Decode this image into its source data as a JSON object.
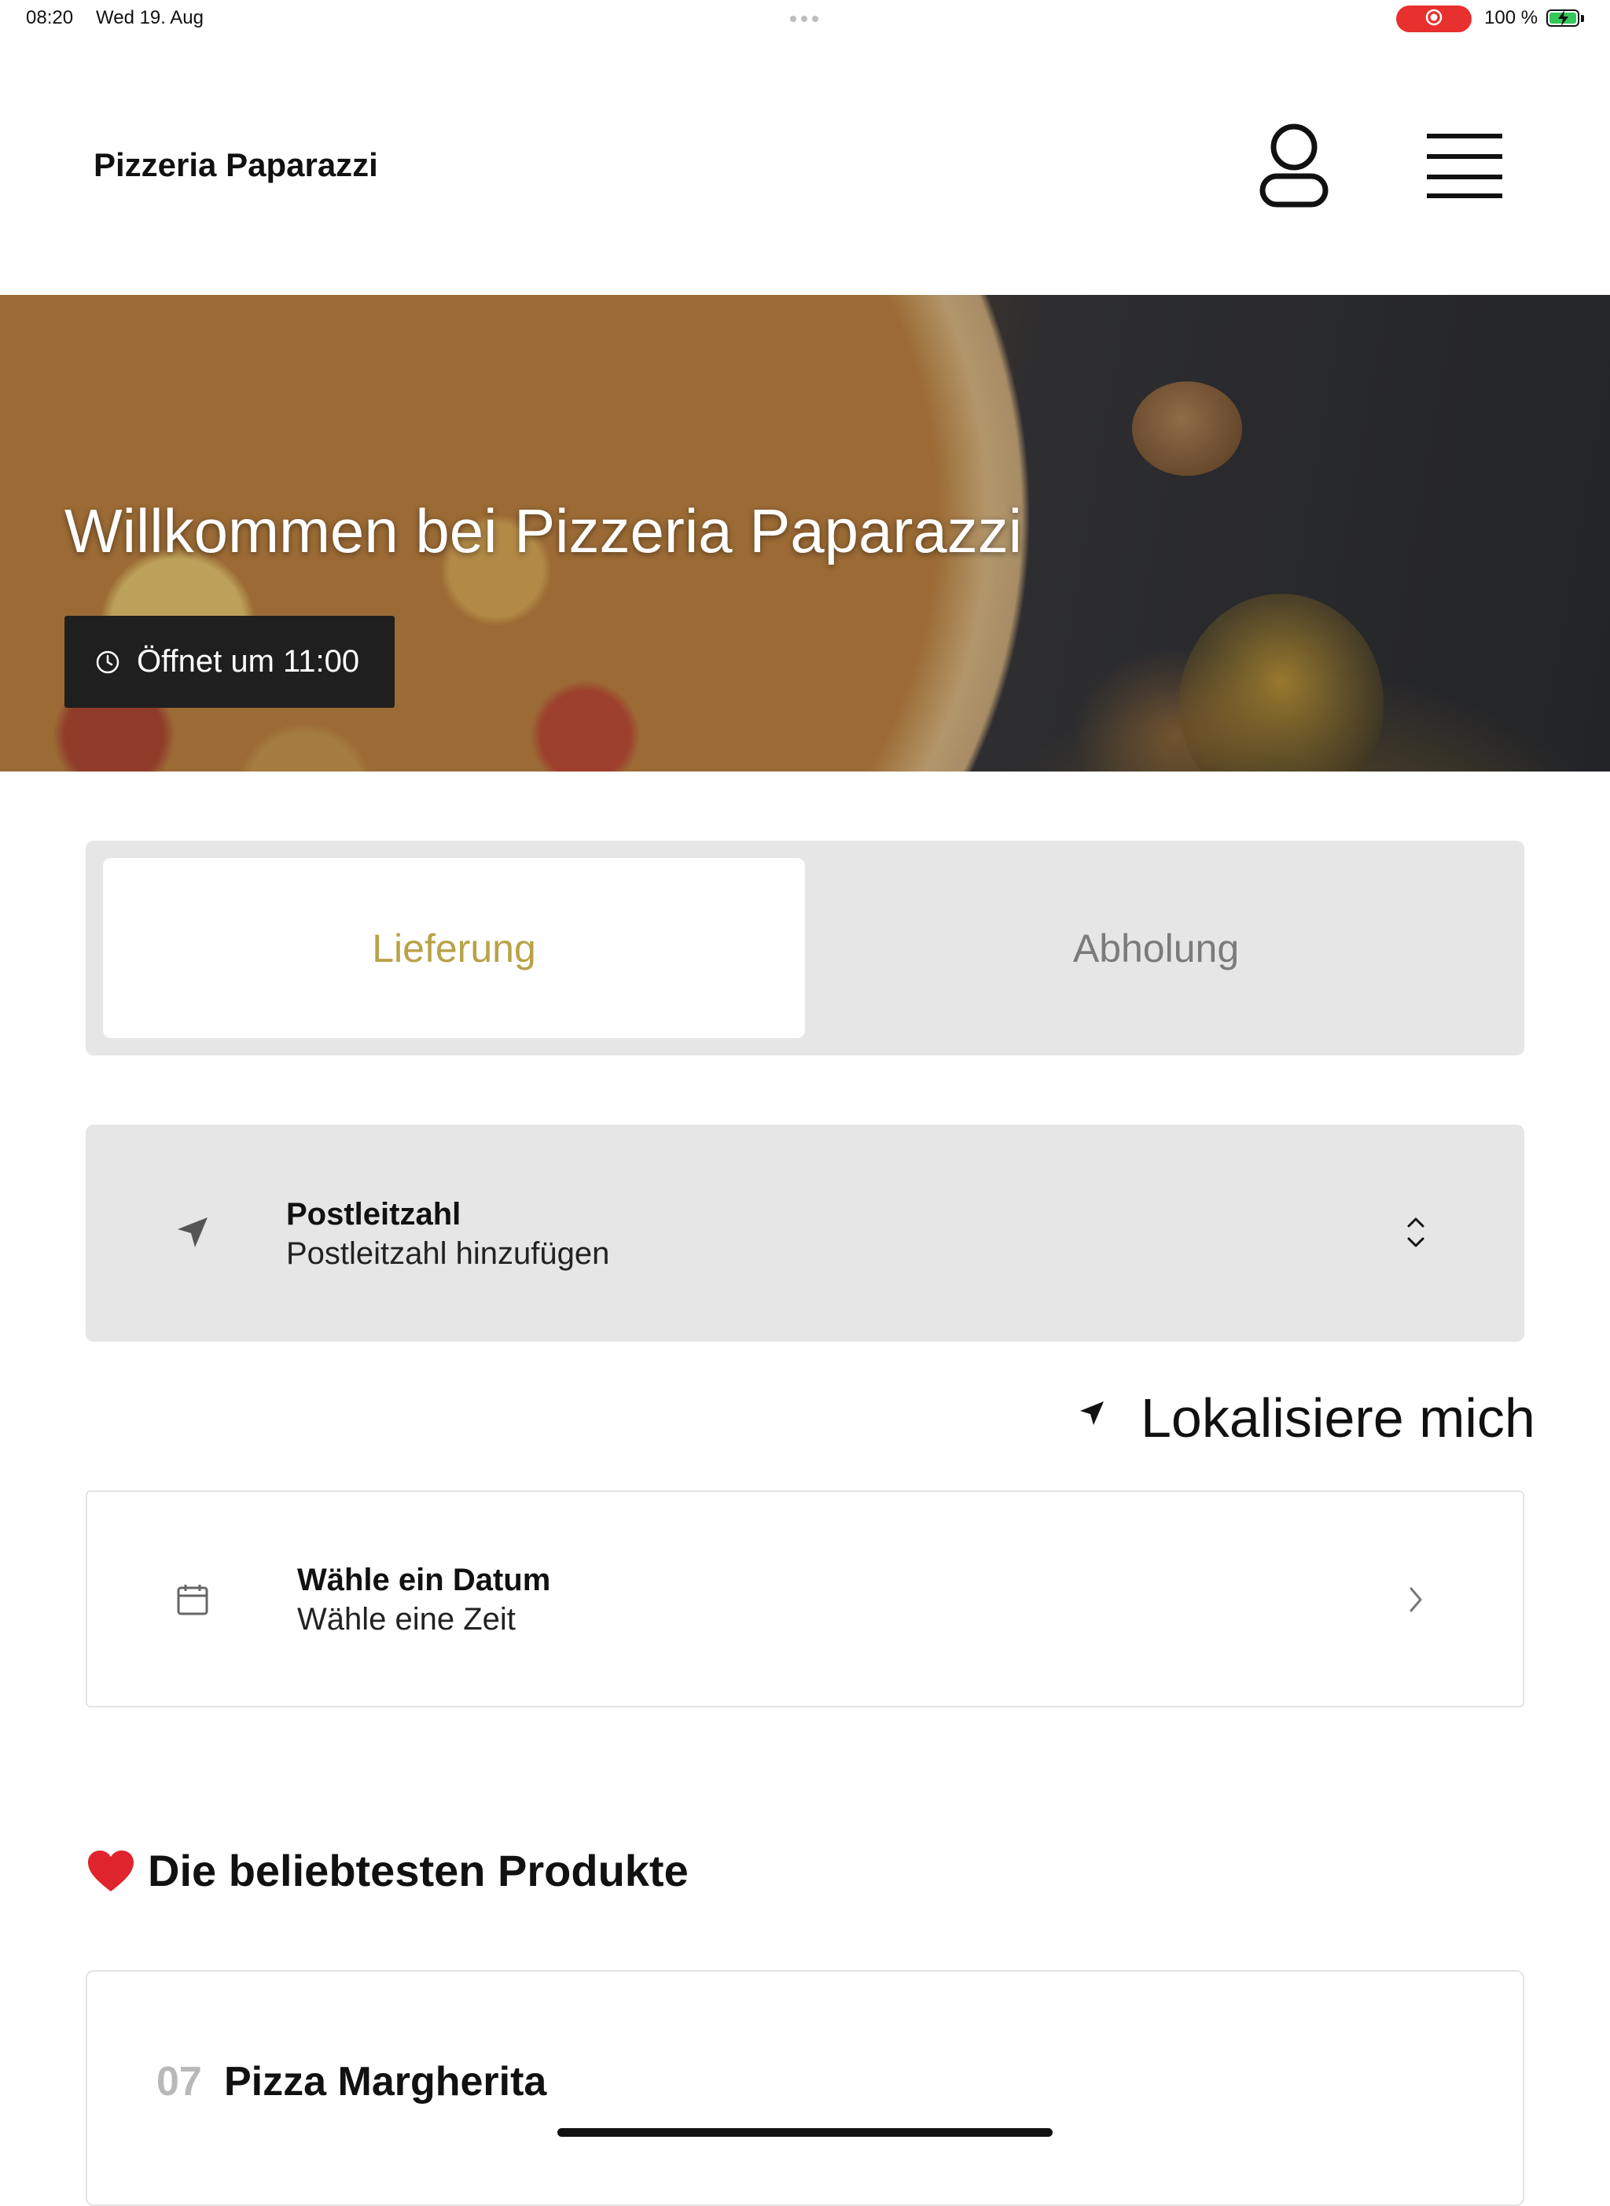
{
  "status_bar": {
    "time": "08:20",
    "date": "Wed 19. Aug",
    "battery": "100 %",
    "battery_level": 1.0,
    "icons": [
      "record-icon",
      "battery-icon",
      "charging-bolt-icon"
    ]
  },
  "header": {
    "brand": "Pizzeria Paparazzi",
    "icons": [
      "user-icon",
      "menu-icon"
    ]
  },
  "hero": {
    "title": "Willkommen bei Pizzeria Paparazzi",
    "hours": "Öffnet um 11:00",
    "icon": "clock-icon"
  },
  "order_mode": {
    "options": [
      "Lieferung",
      "Abholung"
    ],
    "selected": "Lieferung",
    "active_color": "#b9a247",
    "inactive_color": "#7b7b7b"
  },
  "postcode": {
    "title": "Postleitzahl",
    "placeholder": "Postleitzahl hinzufügen",
    "icon": "location-arrow-icon",
    "trailing_icon": "chevron-up-down-icon"
  },
  "locate": {
    "label": "Lokalisiere mich",
    "icon": "location-arrow-icon"
  },
  "schedule": {
    "title": "Wähle ein Datum",
    "subtitle": "Wähle eine Zeit",
    "icon": "calendar-icon",
    "trailing_icon": "chevron-right-icon"
  },
  "popular": {
    "title": "Die beliebtesten Produkte",
    "icon": "heart-icon",
    "products": [
      {
        "number": "07",
        "name": "Pizza Margherita"
      }
    ]
  }
}
